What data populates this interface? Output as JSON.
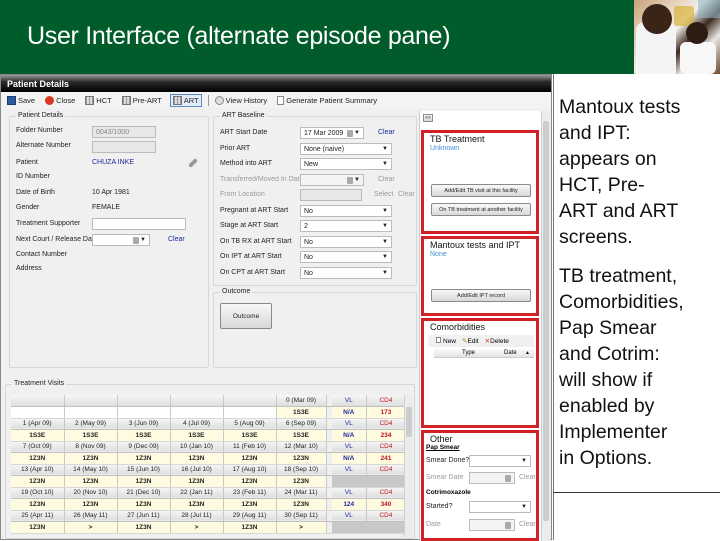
{
  "slide": {
    "title": "User Interface (alternate episode pane)",
    "photo_alt": "health-worker-with-child-photo"
  },
  "window": {
    "title": "Patient Details"
  },
  "toolbar": {
    "items": [
      {
        "label": "Save",
        "icon": "save-icon"
      },
      {
        "label": "Close",
        "icon": "close-icon"
      },
      {
        "label": "HCT",
        "icon": "grid-icon"
      },
      {
        "label": "Pre-ART",
        "icon": "grid-icon"
      },
      {
        "label": "ART",
        "icon": "grid-icon",
        "active": true
      },
      {
        "label": "View History",
        "icon": "history-icon"
      },
      {
        "label": "Generate Patient Summary",
        "icon": "document-icon"
      }
    ]
  },
  "patient_details": {
    "group_label": "Patient Details",
    "folder_number_label": "Folder Number",
    "folder_number": "0043/1000",
    "alternate_number_label": "Alternate Number",
    "alternate_number": "",
    "patient_label": "Patient",
    "patient": "CHUZA INKE",
    "id_number_label": "ID Number",
    "id_number": "",
    "dob_label": "Date of Birth",
    "dob": "10 Apr 1981",
    "gender_label": "Gender",
    "gender": "FEMALE",
    "supporter_label": "Treatment Supporter",
    "supporter": "",
    "next_court_label": "Next Court / Release Date:",
    "next_court": "",
    "clear": "Clear",
    "contact_label": "Contact Number",
    "address_label": "Address"
  },
  "art_baseline": {
    "group_label": "ART Baseline",
    "fields": [
      {
        "label": "ART Start Date",
        "value": "17 Mar 2009",
        "type": "date",
        "clear": "Clear"
      },
      {
        "label": "Prior ART",
        "value": "None (naive)",
        "type": "combo"
      },
      {
        "label": "Method into ART",
        "value": "New",
        "type": "combo"
      },
      {
        "label": "Transferred/Moved In Date",
        "value": "",
        "type": "date",
        "clear": "Clear",
        "disabled": true
      },
      {
        "label": "From Location",
        "value": "",
        "type": "text",
        "select": "Select",
        "clear": "Clear",
        "disabled": true
      },
      {
        "label": "Pregnant at ART Start",
        "value": "No",
        "type": "combo"
      },
      {
        "label": "Stage at ART Start",
        "value": "2",
        "type": "combo"
      },
      {
        "label": "On TB RX at ART Start",
        "value": "No",
        "type": "combo"
      },
      {
        "label": "On IPT at ART Start",
        "value": "No",
        "type": "combo"
      },
      {
        "label": "On CPT at ART Start",
        "value": "No",
        "type": "combo"
      }
    ]
  },
  "outcome": {
    "group_label": "Outcome",
    "button": "Outcome"
  },
  "side_pane": {
    "collapse_button": "<<",
    "tb_treatment": {
      "title": "TB Treatment",
      "status": "Unknown",
      "button1": "Add/Edit TB visit at this facility",
      "button2": "On TB treatment at another facility"
    },
    "mantoux": {
      "title": "Mantoux tests and IPT",
      "status": "None",
      "button": "Add/Edit IPT record"
    },
    "comorbidities": {
      "title": "Comorbidities",
      "new": "New",
      "edit": "Edit",
      "delete": "Delete",
      "columns": [
        "Type",
        "Date"
      ]
    },
    "other": {
      "title": "Other",
      "pap_smear": "Pap Smear",
      "smear_done_label": "Smear Done?",
      "smear_done": "",
      "smear_date_label": "Smear Date",
      "clear": "Clear",
      "cotrimoxazole": "Cotrimoxazole",
      "started_label": "Started?",
      "started": "",
      "date_label": "Date"
    }
  },
  "treatment_visits": {
    "group_label": "Treatment Visits",
    "rows": [
      {
        "months": [
          "",
          "",
          "",
          "",
          "",
          "0 (Mar 09)"
        ],
        "regimens": [
          "",
          "",
          "",
          "",
          "",
          "1S3E"
        ],
        "vl_label": "VL",
        "cd4_label": "CD4",
        "vl": "N/A",
        "cd4": "173"
      },
      {
        "months": [
          "1 (Apr 09)",
          "2 (May 09)",
          "3 (Jun 09)",
          "4 (Jul 09)",
          "5 (Aug 09)",
          "6 (Sep 09)"
        ],
        "regimens": [
          "1S3E",
          "1S3E",
          "1S3E",
          "1S3E",
          "1S3E",
          "1S3E"
        ],
        "vl_label": "VL",
        "cd4_label": "CD4",
        "vl": "N/A",
        "cd4": "234"
      },
      {
        "months": [
          "7 (Oct 09)",
          "8 (Nov 09)",
          "9 (Dec 09)",
          "10 (Jan 10)",
          "11 (Feb 10)",
          "12 (Mar 10)"
        ],
        "regimens": [
          "1Z3N",
          "1Z3N",
          "1Z3N",
          "1Z3N",
          "1Z3N",
          "1Z3N"
        ],
        "vl_label": "VL",
        "cd4_label": "CD4",
        "vl": "N/A",
        "cd4": "241"
      },
      {
        "months": [
          "13 (Apr 10)",
          "14 (May 10)",
          "15 (Jun 10)",
          "16 (Jul 10)",
          "17 (Aug 10)",
          "18 (Sep 10)"
        ],
        "regimens": [
          "1Z3N",
          "1Z3N",
          "1Z3N",
          "1Z3N",
          "1Z3N",
          "1Z3N"
        ],
        "vl_label": "VL",
        "cd4_label": "CD4",
        "vl": "",
        "cd4": ""
      },
      {
        "months": [
          "19 (Oct 10)",
          "20 (Nov 10)",
          "21 (Dec 10)",
          "22 (Jan 11)",
          "23 (Feb 11)",
          "24 (Mar 11)"
        ],
        "regimens": [
          "1Z3N",
          "1Z3N",
          "1Z3N",
          "1Z3N",
          "1Z3N",
          "1Z3N"
        ],
        "vl_label": "VL",
        "cd4_label": "CD4",
        "vl": "124",
        "cd4": "340"
      },
      {
        "months": [
          "25 (Apr 11)",
          "26 (May 11)",
          "27 (Jun 11)",
          "28 (Jul 11)",
          "29 (Aug 11)",
          "30 (Sep 11)"
        ],
        "regimens": [
          "1Z3N",
          ">",
          "1Z3N",
          ">",
          "1Z3N",
          ">"
        ],
        "vl_label": "VL",
        "cd4_label": "CD4",
        "vl": "",
        "cd4": ""
      }
    ]
  },
  "notes": {
    "note1": [
      "Mantoux tests",
      "and IPT:",
      "appears on",
      "HCT, Pre-",
      "ART and ART",
      "screens."
    ],
    "note2": [
      "TB treatment,",
      "Comorbidities,",
      "Pap Smear",
      "and Cotrim:",
      "will show if",
      "enabled by",
      "Implementer",
      "in Options."
    ]
  },
  "colors": {
    "header_green": "#005c2a",
    "highlight_red": "#d32027",
    "link_blue": "#1b2a9c",
    "status_blue": "#3a8dd8",
    "cd4_red": "#c0161d",
    "regimen_yellow": "#fffbe0"
  }
}
